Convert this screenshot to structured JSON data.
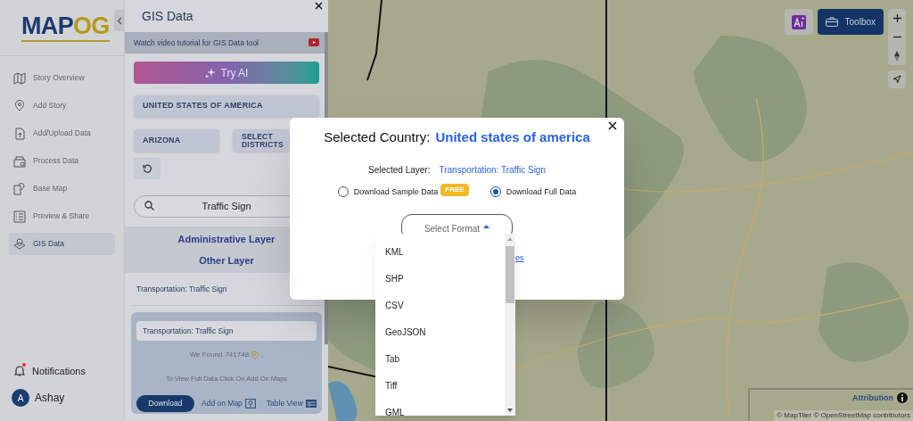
{
  "logo": {
    "primary": "MAP",
    "accent": "OG"
  },
  "nav": [
    {
      "label": "Story Overview",
      "selected": false
    },
    {
      "label": "Add Story",
      "selected": false
    },
    {
      "label": "Add/Upload Data",
      "selected": false
    },
    {
      "label": "Process Data",
      "selected": false
    },
    {
      "label": "Base Map",
      "selected": false
    },
    {
      "label": "Preview & Share",
      "selected": false
    },
    {
      "label": "GIS Data",
      "selected": true
    }
  ],
  "notifications": {
    "label": "Notifications",
    "unread": true
  },
  "user": {
    "initial": "A",
    "name": "Ashay"
  },
  "panel": {
    "title": "GIS Data",
    "tutorial": "Watch video tutorial for GIS Data tool",
    "try_ai": "Try AI",
    "country": "UNITED STATES OF AMERICA",
    "state": "ARIZONA",
    "districts": "SELECT DISTRICTS",
    "search": "Traffic Sign",
    "layer_groups": [
      "Administrative Layer",
      "Other Layer"
    ],
    "selected_layer": "Transportation: Traffic Sign",
    "card": {
      "layer": "Transportation: Traffic Sign",
      "found_label": "We Found",
      "count": "741748",
      "count_suffix": ",",
      "hint": "To View Full Data Click On Add On Maps",
      "download": "Download",
      "add_on_map": "Add on Map",
      "table_view": "Table View"
    }
  },
  "modal": {
    "country_label": "Selected Country:",
    "country": "United states of america",
    "layer_label": "Selected Layer:",
    "layer": "Transportation: Traffic Sign",
    "options": [
      {
        "label": "Download Sample Data",
        "badge": "FREE",
        "selected": false
      },
      {
        "label": "Download Full Data",
        "selected": true
      }
    ],
    "format_select": "Select Format",
    "expanded": true,
    "link_tail": "es",
    "formats": [
      "KML",
      "SHP",
      "CSV",
      "GeoJSON",
      "Tab",
      "Tiff",
      "GML"
    ]
  },
  "map": {
    "toolbox": "Toolbox",
    "attribution": "Attribution",
    "credits": "© MapTiler © OpenStreetMap contributors"
  }
}
